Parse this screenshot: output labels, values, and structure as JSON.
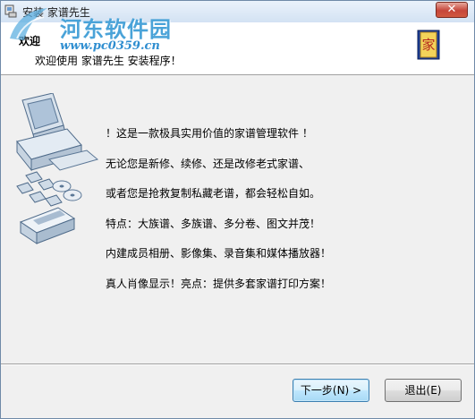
{
  "window": {
    "title": "安装 家谱先生"
  },
  "watermark": {
    "name": "河东软件园",
    "url": "www.pc0359.cn"
  },
  "header": {
    "title": "欢迎",
    "subtitle": "欢迎使用 家谱先生 安装程序！",
    "book_glyph": "家"
  },
  "content": {
    "lines": [
      "！这是一款极具实用价值的家谱管理软件 ！",
      "无论您是新修、续修、还是改修老式家谱、",
      "或者您是抢救复制私藏老谱，都会轻松自如。",
      "特点：大族谱、多族谱、多分卷、图文并茂！",
      "内建成员相册、影像集、录音集和媒体播放器！",
      "真人肖像显示！亮点：提供多套家谱打印方案！"
    ]
  },
  "buttons": {
    "next": "下一步(N) >",
    "exit": "退出(E)"
  },
  "colors": {
    "title_close": "#c6463a",
    "default_button": "#3c7fb1",
    "watermark": "#4aa3d8"
  }
}
